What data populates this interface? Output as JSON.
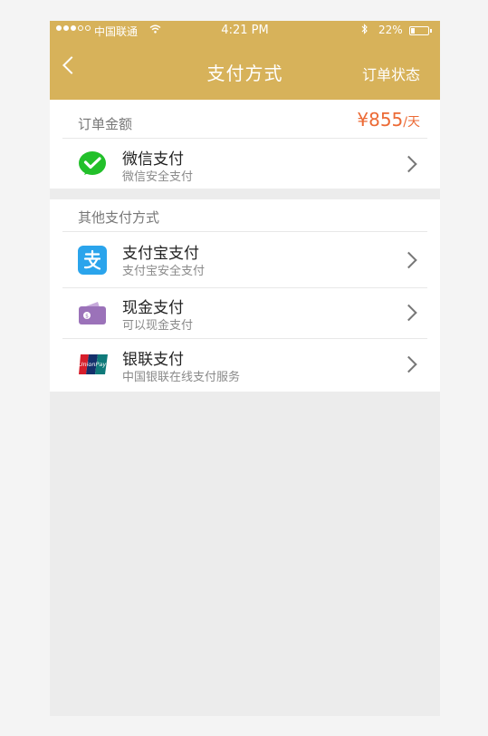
{
  "status_bar": {
    "carrier": "中国联通",
    "time": "4:21 PM",
    "battery": "22%",
    "battery_level": 0.22
  },
  "nav": {
    "title": "支付方式",
    "right_link": "订单状态"
  },
  "order": {
    "label": "订单金额",
    "amount": "¥855",
    "unit": "/天"
  },
  "wechat": {
    "name": "微信支付",
    "desc": "微信安全支付"
  },
  "other_section": {
    "label": "其他支付方式"
  },
  "methods": [
    {
      "name": "支付宝支付",
      "desc": "支付宝安全支付",
      "icon": "alipay-icon"
    },
    {
      "name": "现金支付",
      "desc": "可以现金支付",
      "icon": "wallet-icon"
    },
    {
      "name": "银联支付",
      "desc": "中国银联在线支付服务",
      "icon": "unionpay-icon"
    }
  ],
  "colors": {
    "header": "#d7b25a",
    "price": "#ec6a35",
    "wechat": "#22c02a",
    "alipay": "#2aa4ec",
    "wallet": "#9b72b9"
  }
}
